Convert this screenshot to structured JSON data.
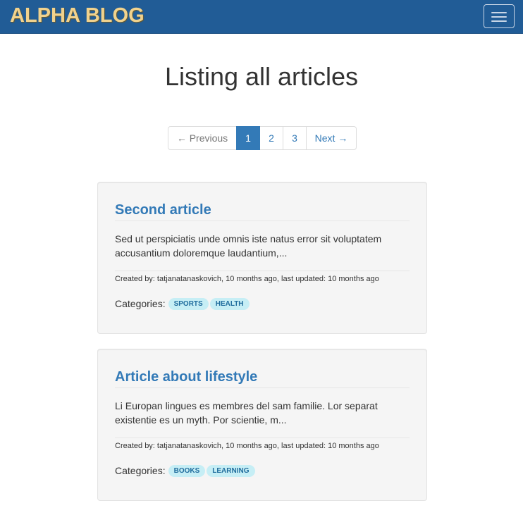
{
  "navbar": {
    "brand": "ALPHA BLOG",
    "toggle_icon": "hamburger-menu-icon"
  },
  "page": {
    "title": "Listing all articles"
  },
  "pagination": {
    "previous": "← Previous",
    "pages": [
      "1",
      "2",
      "3"
    ],
    "active_page": "1",
    "next": "Next →"
  },
  "articles": [
    {
      "title": "Second article",
      "excerpt": "Sed ut perspiciatis unde omnis iste natus error sit voluptatem accusantium doloremque laudantium,...",
      "meta": "Created by: tatjanatanaskovich, 10 months ago, last updated: 10 months ago",
      "categories_label": "Categories:",
      "categories": [
        "SPORTS",
        "HEALTH"
      ]
    },
    {
      "title": "Article about lifestyle",
      "excerpt": "Li Europan lingues es membres del sam familie. Lor separat existentie es un myth. Por scientie, m...",
      "meta": "Created by: tatjanatanaskovich, 10 months ago, last updated: 10 months ago",
      "categories_label": "Categories:",
      "categories": [
        "BOOKS",
        "LEARNING"
      ]
    }
  ],
  "colors": {
    "navbar_bg": "#215c96",
    "brand": "#f1d28d",
    "link": "#337ab7",
    "badge_bg": "#c6eef5",
    "card_bg": "#f5f5f5"
  }
}
